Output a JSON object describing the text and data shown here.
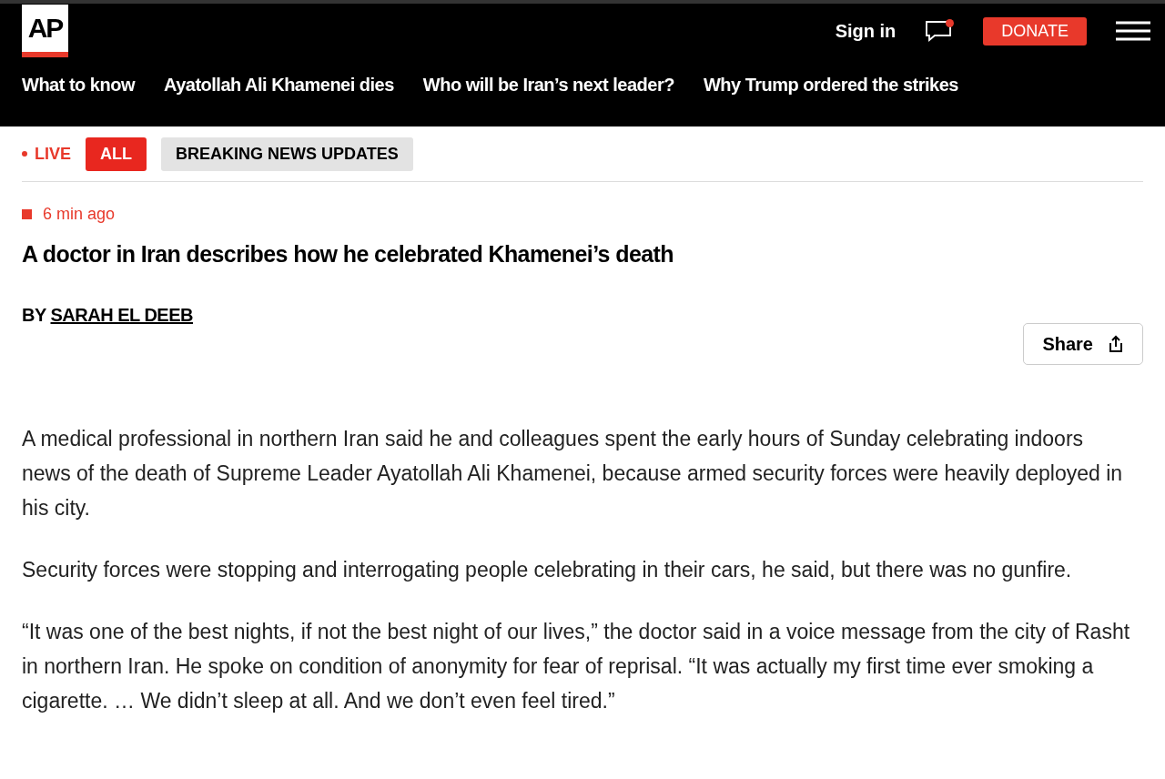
{
  "header": {
    "logo": "AP",
    "sign_in": "Sign in",
    "messages": {
      "has_notification": true
    },
    "donate": "DONATE"
  },
  "nav": [
    {
      "label": "What to know"
    },
    {
      "label": "Ayatollah Ali Khamenei dies"
    },
    {
      "label": "Who will be Iran’s next leader?"
    },
    {
      "label": "Why Trump ordered the strikes"
    }
  ],
  "live": {
    "label": "LIVE",
    "tabs": [
      {
        "label": "ALL",
        "selected": true
      },
      {
        "label": "BREAKING NEWS UPDATES",
        "selected": false
      }
    ]
  },
  "post": {
    "time": "6 min ago",
    "headline": "A doctor in Iran describes how he celebrated Khamenei’s death",
    "byline_prefix": "BY",
    "author": "SARAH EL DEEB",
    "share": "Share",
    "paragraphs": [
      "A medical professional in northern Iran said he and colleagues spent the early hours of Sunday celebrating indoors news of the death of Supreme Leader Ayatollah Ali Khamenei, because armed security forces were heavily deployed in his city.",
      "Security forces were stopping and interrogating people celebrating in their cars, he said, but there was no gunfire.",
      "“It was one of the best nights, if not the best night of our lives,” the doctor said in a voice message from the city of Rasht in northern Iran. He spoke on condition of anonymity for fear of reprisal. “It was actually my first time ever smoking a cigarette. … We didn’t sleep at all. And we don’t even feel tired.”"
    ]
  }
}
